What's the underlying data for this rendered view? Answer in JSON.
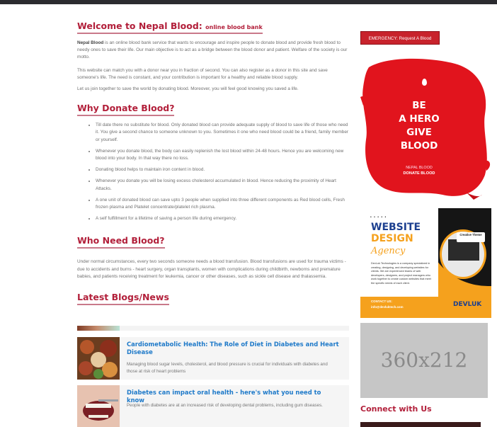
{
  "welcome": {
    "heading": "Welcome to Nepal Blood:",
    "heading_suffix": "online blood bank",
    "brand": "Nepal Blood",
    "p1_rest": " is an online blood bank service that wants to encourage and inspire people to donate blood and provide fresh blood to needy ones to save their life. Our main objective is to act as a bridge between the blood donor and patient. Welfare of the society is our motto.",
    "p2": "This website can match you with a donor near you in fraction of second. You can also register as a donor in this site and save someone's life. The need is constant, and your contribution is important for a healthy and reliable blood supply.",
    "p3": "Let us join together to save the world by donating blood. Moreover, you will feel good knowing you saved a life."
  },
  "why": {
    "heading": "Why Donate Blood?",
    "items": [
      "Till date there no substitute for blood. Only donated blood can provide adequate supply of blood to save life of those who need it. You give a second chance to someone unknown to you. Sometimes it one who need blood could be a friend, family member or yourself.",
      "Whenever you donate blood, the body can easily replenish the lost blood within 24-48 hours. Hence you are welcoming new blood into your body. In that way there no loss.",
      "Donating blood helps to maintain iron content in blood.",
      "Whenever you donate you will be losing excess cholesterol accumulated in blood. Hence reducing the proximity of Heart Attacks.",
      "A one unit of donated blood can save upto 3 people when supplied into three different components as Red blood cells, Fresh frozen plasma and Platelet concentrate/platelet rich plasma.",
      "A self fulfillment for a lifetime of saving a person life during emergency."
    ]
  },
  "who": {
    "heading": "Who Need Blood?",
    "text": "Under normal circumstances, every two seconds someone needs a blood transfusion. Blood transfusions are used for trauma victims - due to accidents and burns - heart surgery, organ transplants, women with complications during childbirth, newborns and premature babies, and patients receiving treatment for leukemia, cancer or other diseases, such as sickle cell disease and thalassemia."
  },
  "blogs": {
    "heading": "Latest Blogs/News",
    "posts": [
      {
        "title": "Cardiometabolic Health: The Role of Diet in Diabetes and Heart Disease",
        "desc": "Managing blood sugar levels, cholesterol, and blood pressure is crucial for individuals with diabetes and those at risk of heart problems"
      },
      {
        "title": "Diabetes can impact oral health - here's what you need to know",
        "desc": "People with diabetes are at an increased risk of developing dental problems, including gum diseases."
      }
    ]
  },
  "sidebar": {
    "emergency_button": "EMERGENCY: Request A Blood",
    "hero": {
      "line1": "BE",
      "line2": "A HERO",
      "line3": "GIVE",
      "line4": "BLOOD",
      "sub1": "NEPAL BLOOD",
      "sub2": "DONATE BLOOD"
    },
    "ad": {
      "dots": "• • • • •",
      "word1": "WEBSITE",
      "word2": "DESIGN",
      "word3": "Agency",
      "copy": "DevLuk Technologies is a company specialized in creating, designing, and developing websites for clients. We are experienced teams of web developers, designers, and project managers who work together to create custom websites that meet the specific needs of each client.",
      "badge": "Creative Theme",
      "contact_label": "CONTACT US:",
      "contact_email": "info@devluktech.com",
      "brand": "DEVLUK"
    },
    "placeholder": "360x212",
    "connect_heading": "Connect with Us"
  },
  "colors": {
    "accent": "#b21f3a",
    "link": "#1f7ac9",
    "emergency": "#c8232c",
    "ad_orange": "#f5a11d"
  }
}
